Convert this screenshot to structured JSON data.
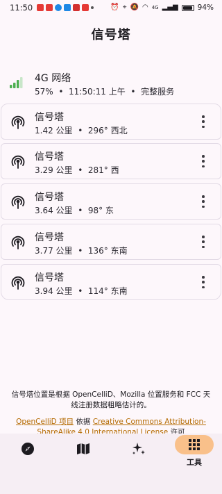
{
  "status_bar": {
    "time": "11:50",
    "network": "4G",
    "battery": "94%"
  },
  "app": {
    "title": "信号塔"
  },
  "serving_cell": {
    "title": "4G 网络",
    "signal": "57%",
    "time": "11:50:11 上午",
    "status": "完整服务",
    "sep": "•"
  },
  "cells": [
    {
      "name": "信号塔",
      "distance": "1.42 公里",
      "bearing": "296° 西北"
    },
    {
      "name": "信号塔",
      "distance": "3.29 公里",
      "bearing": "281° 西"
    },
    {
      "name": "信号塔",
      "distance": "3.64 公里",
      "bearing": "98° 东"
    },
    {
      "name": "信号塔",
      "distance": "3.77 公里",
      "bearing": "136° 东南"
    },
    {
      "name": "信号塔",
      "distance": "3.94 公里",
      "bearing": "114° 东南"
    }
  ],
  "footer": {
    "note": "信号塔位置是根据 OpenCelliD、Mozilla 位置服务和 FCC 天线注册数据粗略估计的。",
    "link1": "OpenCelliD 项目",
    "middle": " 依据 ",
    "link2": "Creative Commons Attribution-ShareAlike 4.0 International License",
    "suffix": " 许可"
  },
  "nav": {
    "items": [
      {
        "icon": "compass-icon"
      },
      {
        "icon": "map-icon"
      },
      {
        "icon": "sparkle-icon"
      },
      {
        "icon": "grid-icon",
        "label": "工具",
        "active": true
      }
    ]
  },
  "colors": {
    "accent": "#f9c08a",
    "signal_green": "#4caf50",
    "link": "#b46a00",
    "background": "#fdf7fb"
  }
}
